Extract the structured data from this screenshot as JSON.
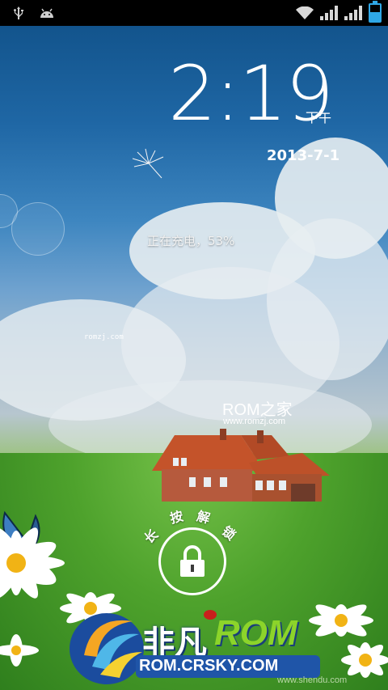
{
  "status_bar": {
    "left_icons": [
      "usb-icon",
      "android-debug-icon"
    ],
    "right_icons": [
      "wifi-icon",
      "signal-1-icon",
      "signal-2-icon",
      "battery-charging-icon"
    ],
    "battery_level": 0.53,
    "colors": {
      "battery": "#2fa7e6",
      "icons": "#d8d8d8"
    }
  },
  "lock_screen": {
    "time": "2:19",
    "ampm": "下午",
    "date": "2013-7-1",
    "charging_status": "正在充电，53%",
    "unlock_hint_chars": [
      "长",
      "按",
      "解",
      "锁"
    ],
    "unlock_icon": "padlock-icon"
  },
  "wallpaper": {
    "watermark_small": "romzj.com",
    "watermark_brand": "ROM之家",
    "watermark_url": "www.romzj.com"
  },
  "overlay_logo": {
    "name_cn": "非凡",
    "name_en": "ROM",
    "url": "ROM.CRSKY.COM",
    "corner_text": "www.shendu.com",
    "colors": {
      "name_en": "#8cd42a",
      "url_box": "#1f55a8"
    }
  }
}
